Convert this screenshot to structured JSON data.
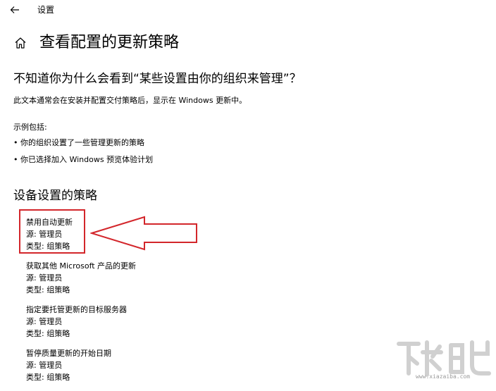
{
  "window": {
    "app_title": "设置"
  },
  "page": {
    "title": "查看配置的更新策略",
    "question_heading": "不知道你为什么会看到“某些设置由你的组织来管理”？",
    "description": "此文本通常会在安装并配置交付策略后，显示在 Windows 更新中。",
    "examples_label": "示例包括:",
    "examples": [
      "你的组织设置了一些管理更新的策略",
      "你已选择加入 Windows 预览体验计划"
    ],
    "bullet_glyph": "•",
    "policies_heading": "设备设置的策略",
    "policies": [
      {
        "name": "禁用自动更新",
        "source": "源: 管理员",
        "type": "类型: 组策略"
      },
      {
        "name": "获取其他 Microsoft 产品的更新",
        "source": "源: 管理员",
        "type": "类型: 组策略"
      },
      {
        "name": "指定要托管更新的目标服务器",
        "source": "源: 管理员",
        "type": "类型: 组策略"
      },
      {
        "name": "暂停质量更新的开始日期",
        "source": "源: 管理员",
        "type": "类型: 组策略"
      }
    ]
  },
  "annotation": {
    "color": "#d3262b",
    "highlighted_policy_index": 0
  },
  "watermark": {
    "text": "www.xiazaiba.com"
  },
  "icons": {
    "back": "back-arrow-icon",
    "home": "home-icon"
  }
}
